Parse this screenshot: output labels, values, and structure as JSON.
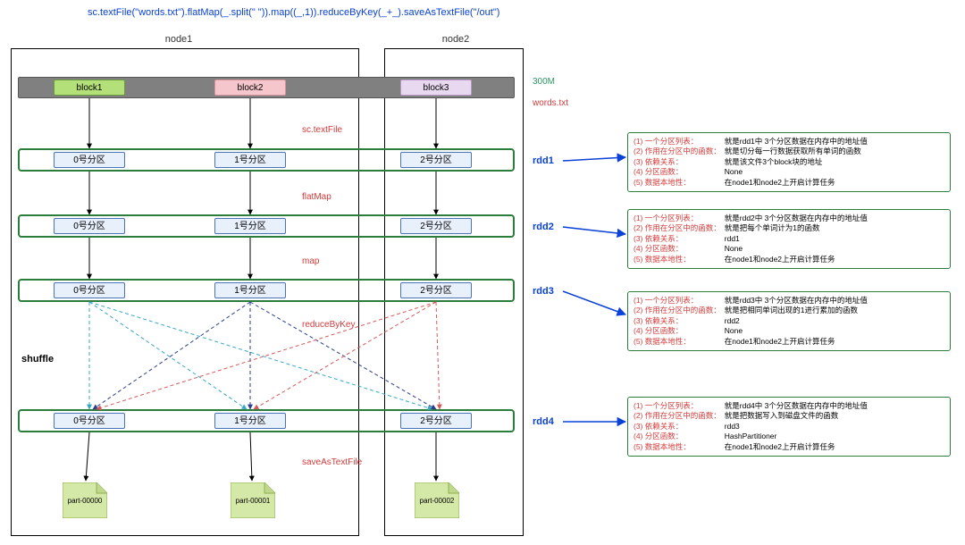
{
  "code": "sc.textFile(\"words.txt\").flatMap(_.split(\" \")).map((_,1)).reduceByKey(_+_).saveAsTextFile(\"/out\")",
  "nodes": {
    "node1": "node1",
    "node2": "node2"
  },
  "blocks": {
    "b1": "block1",
    "b2": "block2",
    "b3": "block3"
  },
  "side": {
    "size": "300M",
    "file": "words.txt"
  },
  "ops": {
    "textFile": "sc.textFile",
    "flatMap": "flatMap",
    "map": "map",
    "reduceByKey": "reduceByKey",
    "saveAsTextFile": "saveAsTextFile"
  },
  "partitions": {
    "p0": "0号分区",
    "p1": "1号分区",
    "p2": "2号分区"
  },
  "rdd_labels": {
    "r1": "rdd1",
    "r2": "rdd2",
    "r3": "rdd3",
    "r4": "rdd4"
  },
  "shuffle": "shuffle",
  "files": {
    "f0": "part-00000",
    "f1": "part-00001",
    "f2": "part-00002"
  },
  "info_keys": {
    "k1": "(1)  一个分区列表：",
    "k2": "(2)  作用在分区中的函数：",
    "k3": "(3)  依赖关系：",
    "k4": "(4)  分区函数：",
    "k5": "(5)  数据本地性："
  },
  "info": {
    "r1": {
      "v1": "就是rdd1中 3个分区数据在内存中的地址值",
      "v2": "就是切分每一行数据获取所有单词的函数",
      "v3": "就是该文件3个block块的地址",
      "v4": "None",
      "v5": "在node1和node2上开启计算任务"
    },
    "r2": {
      "v1": "就是rdd2中 3个分区数据在内存中的地址值",
      "v2": "就是把每个单词计为1的函数",
      "v3": "rdd1",
      "v4": "None",
      "v5": "在node1和node2上开启计算任务"
    },
    "r3": {
      "v1": "就是rdd3中 3个分区数据在内存中的地址值",
      "v2": "就是把相同单词出现的1进行累加的函数",
      "v3": "rdd2",
      "v4": "None",
      "v5": "在node1和node2上开启计算任务"
    },
    "r4": {
      "v1": "就是rdd4中 3个分区数据在内存中的地址值",
      "v2": "就是把数据写入到磁盘文件的函数",
      "v3": "rdd3",
      "v4": "HashPartitioner",
      "v5": "在node1和node2上开启计算任务"
    }
  },
  "chart_data": {
    "type": "diagram",
    "title": "Spark RDD lineage for word count",
    "source_file": "words.txt",
    "source_size": "300M",
    "blocks": [
      "block1",
      "block2",
      "block3"
    ],
    "nodes": {
      "node1": [
        "block1",
        "block2"
      ],
      "node2": [
        "block3"
      ]
    },
    "pipeline": [
      {
        "op": "sc.textFile",
        "out": "rdd1",
        "partitions": [
          "0号分区",
          "1号分区",
          "2号分区"
        ]
      },
      {
        "op": "flatMap",
        "out": "rdd2",
        "partitions": [
          "0号分区",
          "1号分区",
          "2号分区"
        ]
      },
      {
        "op": "map",
        "out": "rdd3",
        "partitions": [
          "0号分区",
          "1号分区",
          "2号分区"
        ]
      },
      {
        "op": "reduceByKey",
        "out": "rdd4",
        "partitions": [
          "0号分区",
          "1号分区",
          "2号分区"
        ],
        "shuffle": true
      },
      {
        "op": "saveAsTextFile",
        "outputs": [
          "part-00000",
          "part-00001",
          "part-00002"
        ]
      }
    ]
  }
}
